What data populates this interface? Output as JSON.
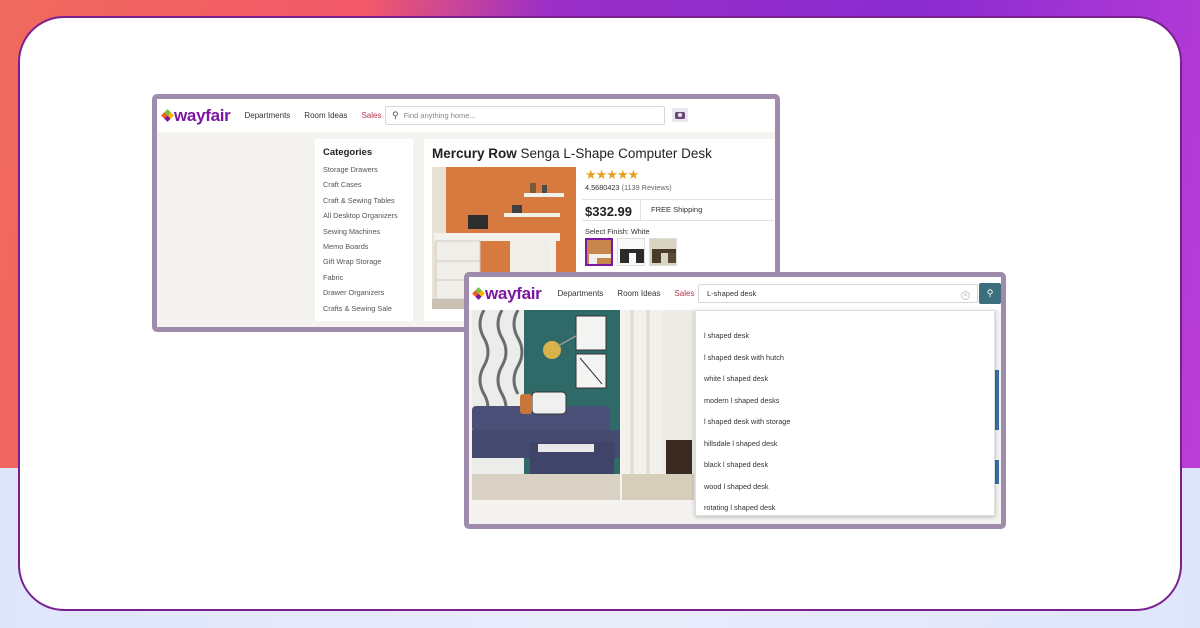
{
  "window1": {
    "header": {
      "logo": "wayfair",
      "nav": [
        "Departments",
        "Room Ideas",
        "Sales"
      ],
      "search_placeholder": "Find anything home..."
    },
    "categories": {
      "title": "Categories",
      "items": [
        "Storage Drawers",
        "Craft Cases",
        "Craft & Sewing Tables",
        "All Desktop Organizers",
        "Sewing Machines",
        "Memo Boards",
        "Gift Wrap Storage",
        "Fabric",
        "Drawer Organizers",
        "Crafts & Sewing Sale"
      ]
    },
    "product": {
      "brand": "Mercury Row",
      "name": "Senga L-Shape Computer Desk",
      "stars": "★★★★★",
      "rating": "4.5680423",
      "reviews": "(1139 Reviews)",
      "price": "$332.99",
      "shipping": "FREE Shipping",
      "finish_label": "Select Finish:",
      "finish_value": "White"
    }
  },
  "window2": {
    "header": {
      "logo": "wayfair",
      "nav": [
        "Departments",
        "Room Ideas",
        "Sales"
      ],
      "search_value": "L-shaped desk"
    },
    "suggestions": [
      "l shaped desk",
      "l shaped desk with hutch",
      "white l shaped desk",
      "modern l shaped desks",
      "l shaped desk with storage",
      "hillsdale l shaped desk",
      "black l shaped desk",
      "wood l shaped desk",
      "rotating l shaped desk"
    ]
  },
  "icons": {
    "search": "magnifier",
    "camera": "camera",
    "clear": "close-circle"
  },
  "colors": {
    "brand": "#7b189f",
    "sales": "#b3344a",
    "search_button": "#3c6f7d",
    "star": "#e3a320",
    "window_border": "#9f8cac"
  }
}
